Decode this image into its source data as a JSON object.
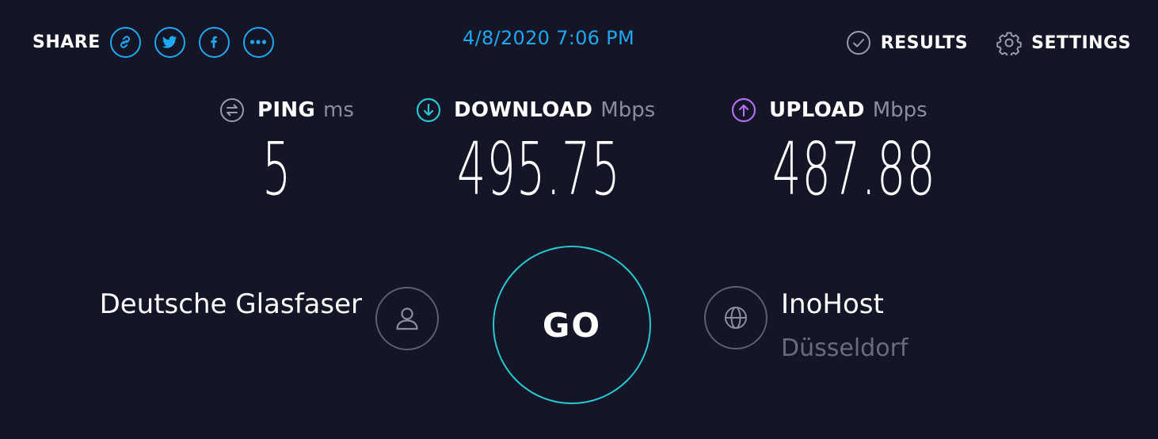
{
  "header": {
    "share_label": "SHARE",
    "share_buttons": [
      {
        "icon": "link-icon"
      },
      {
        "icon": "twitter-icon"
      },
      {
        "icon": "facebook-icon"
      },
      {
        "icon": "more-icon"
      }
    ],
    "timestamp": "4/8/2020 7:06 PM",
    "results_label": "RESULTS",
    "settings_label": "SETTINGS"
  },
  "metrics": {
    "ping": {
      "label": "PING",
      "unit": "ms",
      "value": "5"
    },
    "download": {
      "label": "DOWNLOAD",
      "unit": "Mbps",
      "value": "495.75"
    },
    "upload": {
      "label": "UPLOAD",
      "unit": "Mbps",
      "value": "487.88"
    }
  },
  "isp": {
    "name": "Deutsche Glasfaser"
  },
  "go": {
    "label": "GO"
  },
  "server": {
    "name": "InoHost",
    "location": "Düsseldorf"
  },
  "colors": {
    "background": "#141526",
    "accent_blue": "#1fa8f2",
    "download_teal": "#28c7d1",
    "upload_purple": "#b26ef0",
    "muted_gray": "#8c8d9c"
  }
}
